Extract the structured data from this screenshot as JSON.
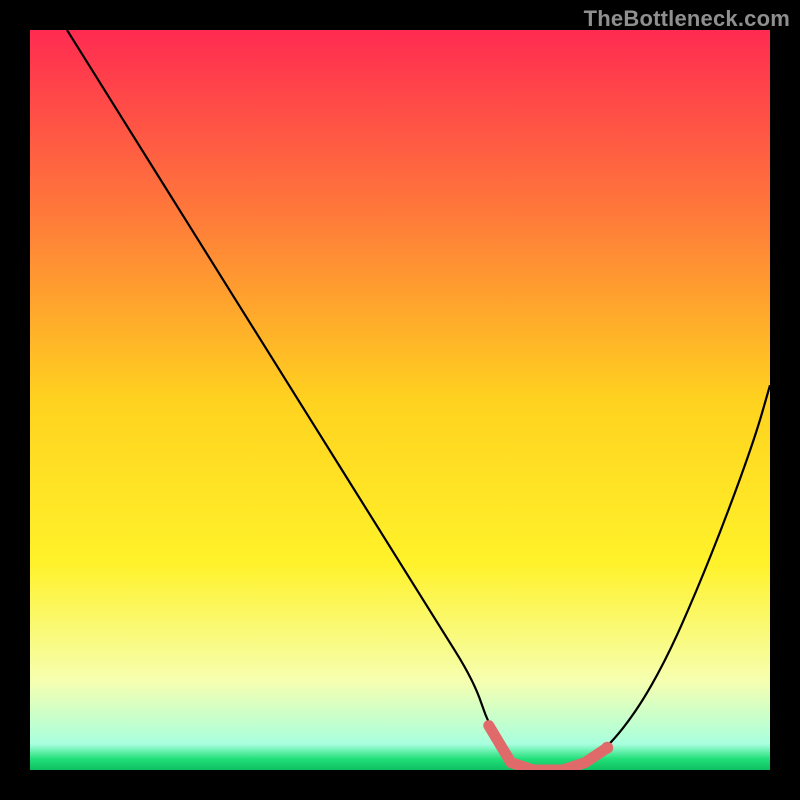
{
  "watermark": "TheBottleneck.com",
  "chart_data": {
    "type": "line",
    "title": "",
    "xlabel": "",
    "ylabel": "",
    "xlim": [
      0,
      100
    ],
    "ylim": [
      0,
      100
    ],
    "grid": false,
    "legend": false,
    "background_gradient": {
      "stops": [
        {
          "offset": 0.0,
          "color": "#ff2b51"
        },
        {
          "offset": 0.25,
          "color": "#ff7a3a"
        },
        {
          "offset": 0.5,
          "color": "#ffd21f"
        },
        {
          "offset": 0.72,
          "color": "#fff22a"
        },
        {
          "offset": 0.88,
          "color": "#f6ffb0"
        },
        {
          "offset": 0.965,
          "color": "#a8ffde"
        },
        {
          "offset": 0.985,
          "color": "#22e07a"
        },
        {
          "offset": 1.0,
          "color": "#0fbf60"
        }
      ]
    },
    "series": [
      {
        "name": "bottleneck-curve",
        "color": "#000000",
        "x": [
          5,
          10,
          15,
          20,
          25,
          30,
          35,
          40,
          45,
          50,
          55,
          60,
          62,
          65,
          68,
          72,
          75,
          78,
          82,
          86,
          90,
          94,
          98,
          100
        ],
        "values": [
          100,
          92,
          84,
          76,
          68,
          60,
          52,
          44,
          36,
          28,
          20,
          12,
          6,
          1,
          0,
          0,
          1,
          3,
          8,
          15,
          24,
          34,
          45,
          52
        ]
      }
    ],
    "highlight_segment": {
      "name": "optimal-range",
      "color": "#e06a6a",
      "x": [
        62,
        65,
        68,
        72,
        75,
        78
      ],
      "values": [
        6,
        1,
        0,
        0,
        1,
        3
      ],
      "endpoint_radius": 6
    }
  }
}
